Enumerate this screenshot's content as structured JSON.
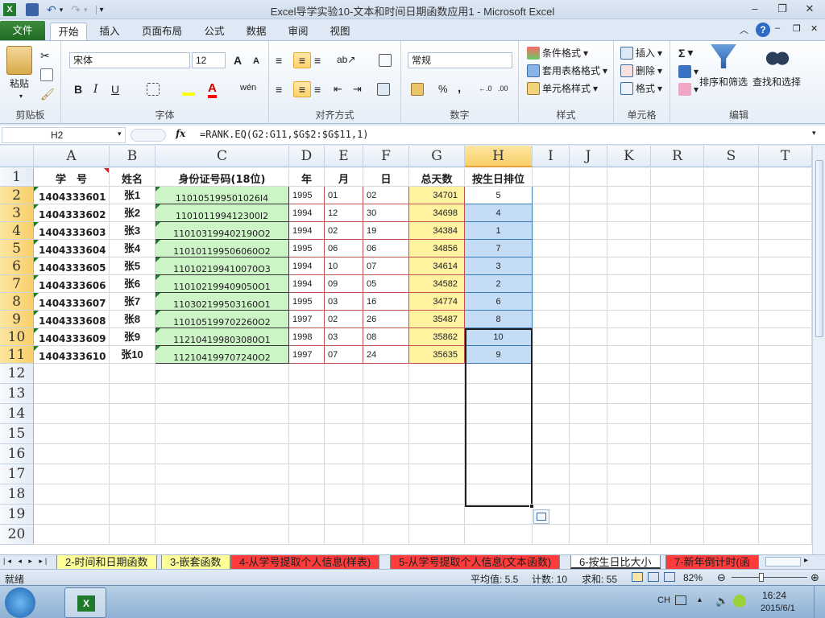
{
  "window": {
    "title": "Excel导学实验10-文本和时间日期函数应用1 - Microsoft Excel",
    "qat_more": "▾"
  },
  "ribbon_tabs": [
    "文件",
    "开始",
    "插入",
    "页面布局",
    "公式",
    "数据",
    "审阅",
    "视图"
  ],
  "ribbon": {
    "clipboard": {
      "paste": "粘贴",
      "label": "剪贴板"
    },
    "font": {
      "name": "宋体",
      "size": "12",
      "grow": "A",
      "shrink": "A",
      "bold": "B",
      "italic": "I",
      "underline": "U",
      "label": "字体",
      "wen": "wén"
    },
    "align": {
      "label": "对齐方式"
    },
    "number": {
      "format": "常规",
      "percent": "%",
      "comma": ",",
      "dec_inc": "←.0",
      "dec_dec": ".00",
      "label": "数字"
    },
    "styles": {
      "cond": "条件格式",
      "table": "套用表格格式",
      "cell": "单元格样式",
      "label": "样式"
    },
    "cells": {
      "insert": "插入",
      "delete": "删除",
      "format": "格式",
      "label": "单元格"
    },
    "editing": {
      "sort": "排序和筛选",
      "find": "查找和选择",
      "label": "编辑",
      "sigma": "Σ"
    }
  },
  "formula_bar": {
    "name_box": "H2",
    "fx": "fx",
    "formula": "=RANK.EQ(G2:G11,$G$2:$G$11,1)"
  },
  "columns": [
    "A",
    "B",
    "C",
    "D",
    "E",
    "F",
    "G",
    "H",
    "I",
    "J",
    "K",
    "R",
    "S",
    "T"
  ],
  "rows": [
    "1",
    "2",
    "3",
    "4",
    "5",
    "6",
    "7",
    "8",
    "9",
    "10",
    "11",
    "12",
    "13",
    "14",
    "15",
    "16",
    "17",
    "18",
    "19",
    "20"
  ],
  "headers": {
    "a": "学　号",
    "b": "姓名",
    "c": "身份证号码(18位)",
    "d": "年",
    "e": "月",
    "f": "日",
    "g": "总天数",
    "h": "按生日排位"
  },
  "data_rows": [
    {
      "id": "1404333601",
      "name": "张1",
      "idno": "110105199501026I4",
      "y": "1995",
      "m": "01",
      "d": "02",
      "total": "34701",
      "rank": "5"
    },
    {
      "id": "1404333602",
      "name": "张2",
      "idno": "110101199412300I2",
      "y": "1994",
      "m": "12",
      "d": "30",
      "total": "34698",
      "rank": "4"
    },
    {
      "id": "1404333603",
      "name": "张3",
      "idno": "110103199402190O2",
      "y": "1994",
      "m": "02",
      "d": "19",
      "total": "34384",
      "rank": "1"
    },
    {
      "id": "1404333604",
      "name": "张4",
      "idno": "110101199506060O2",
      "y": "1995",
      "m": "06",
      "d": "06",
      "total": "34856",
      "rank": "7"
    },
    {
      "id": "1404333605",
      "name": "张5",
      "idno": "110102199410070O3",
      "y": "1994",
      "m": "10",
      "d": "07",
      "total": "34614",
      "rank": "3"
    },
    {
      "id": "1404333606",
      "name": "张6",
      "idno": "110102199409050O1",
      "y": "1994",
      "m": "09",
      "d": "05",
      "total": "34582",
      "rank": "2"
    },
    {
      "id": "1404333607",
      "name": "张7",
      "idno": "110302199503160O1",
      "y": "1995",
      "m": "03",
      "d": "16",
      "total": "34774",
      "rank": "6"
    },
    {
      "id": "1404333608",
      "name": "张8",
      "idno": "110105199702260O2",
      "y": "1997",
      "m": "02",
      "d": "26",
      "total": "35487",
      "rank": "8"
    },
    {
      "id": "1404333609",
      "name": "张9",
      "idno": "112104199803080O1",
      "y": "1998",
      "m": "03",
      "d": "08",
      "total": "35862",
      "rank": "10"
    },
    {
      "id": "1404333610",
      "name": "张10",
      "idno": "112104199707240O2",
      "y": "1997",
      "m": "07",
      "d": "24",
      "total": "35635",
      "rank": "9"
    }
  ],
  "sheet_tabs": [
    {
      "label": "2-时间和日期函数",
      "color": "#ffff99",
      "active": false
    },
    {
      "label": "3-嵌套函数",
      "color": "#ffff99",
      "active": false
    },
    {
      "label": "4-从学号提取个人信息(样表)",
      "color": "#ff3b3b",
      "active": false
    },
    {
      "label": "5-从学号提取个人信息(文本函数)",
      "color": "#ff3b3b",
      "active": false
    },
    {
      "label": "6-按生日比大小",
      "color": "#ffffff",
      "active": true
    },
    {
      "label": "7-新年倒计时(函",
      "color": "#ff3b3b",
      "active": false
    }
  ],
  "status": {
    "ready": "就绪",
    "average": "平均值: 5.5",
    "count": "计数: 10",
    "sum": "求和: 55",
    "zoom": "82%"
  },
  "taskbar": {
    "lang": "CH",
    "time": "16:24",
    "date": "2015/6/1"
  }
}
